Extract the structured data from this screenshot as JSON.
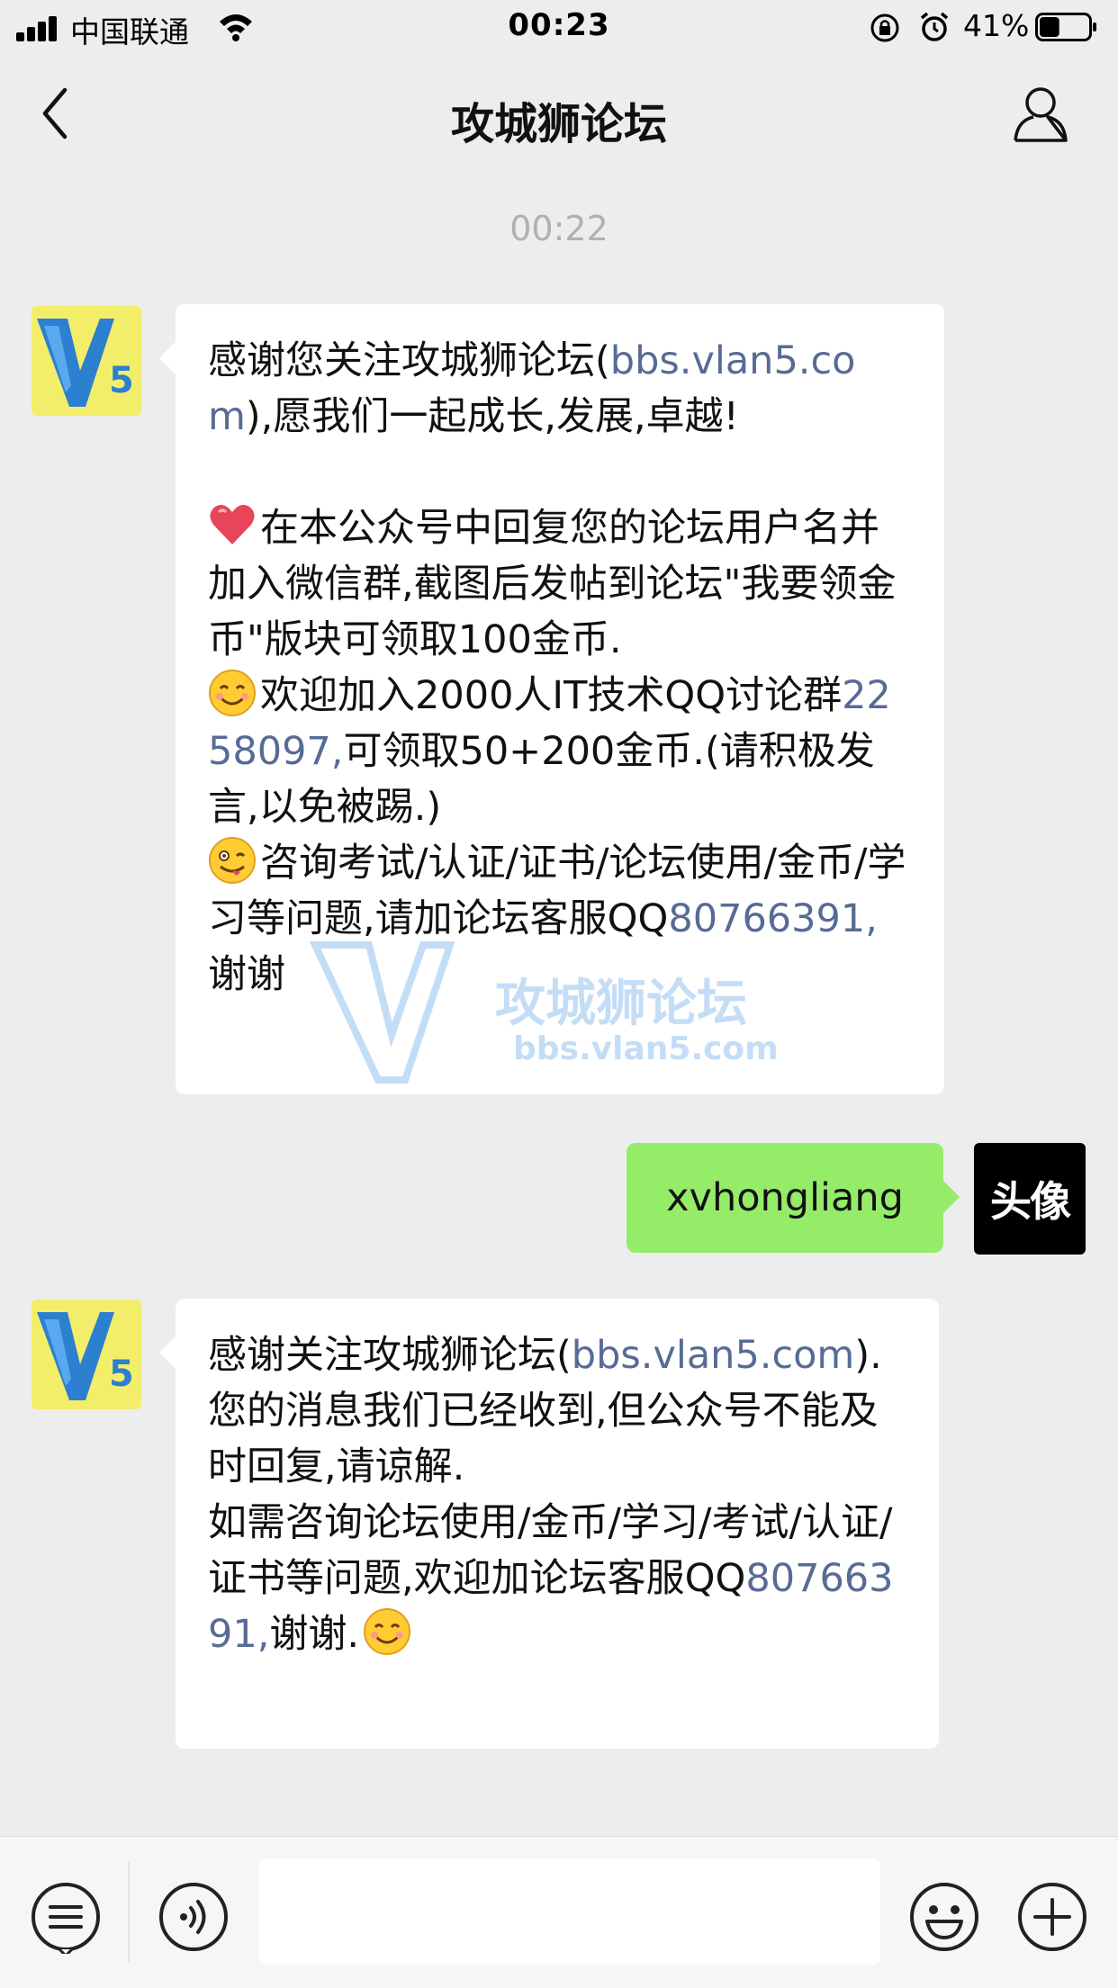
{
  "status_bar": {
    "carrier": "中国联通",
    "time": "00:23",
    "battery_percent": "41%",
    "battery_level": 0.41
  },
  "nav": {
    "title": "攻城狮论坛"
  },
  "chat": {
    "timestamp": "00:22",
    "msg1": {
      "l1a": "感谢您关注攻城狮论坛(",
      "l1link": "bbs.vlan5.com",
      "l1b": "),愿我们一起成长,发展,卓越!",
      "p2": "在本公众号中回复您的论坛用户名并加入微信群,截图后发帖到论坛\"我要领金币\"版块可领取100金币.",
      "p3a": "欢迎加入2000人IT技术QQ讨论群",
      "p3link": "2258097,",
      "p3b": "可领取50+200金币.(请积极发言,以免被踢.)",
      "p4a": "咨询考试/认证/证书/论坛使用/金币/学习等问题,请加论坛客服QQ",
      "p4link": "80766391,",
      "p4b": "谢谢"
    },
    "msg2": {
      "text": "xvhongliang"
    },
    "user_avatar_label": "头像",
    "msg3": {
      "l1a": "感谢关注攻城狮论坛(",
      "l1link": "bbs.vlan5.com",
      "l1b": ").",
      "p2": "您的消息我们已经收到,但公众号不能及时回复,请谅解.",
      "p3a": "如需咨询论坛使用/金币/学习/考试/认证/证书等问题,欢迎加论坛客服QQ",
      "p3link": "80766391,",
      "p3b": "谢谢."
    },
    "watermark": {
      "text": "攻城狮论坛",
      "url": "bbs.vlan5.com"
    }
  },
  "icons": {
    "back": "chevron-left-icon",
    "profile": "person-icon",
    "menu": "list-icon",
    "voice": "voice-icon",
    "emoji": "emoji-icon",
    "plus": "plus-icon"
  },
  "colors": {
    "background": "#ededed",
    "outgoing_bubble": "#95ec69",
    "incoming_bubble": "#ffffff",
    "link": "#576b95",
    "v5_yellow": "#f3ee6a",
    "v5_blue": "#2d7fd0"
  }
}
